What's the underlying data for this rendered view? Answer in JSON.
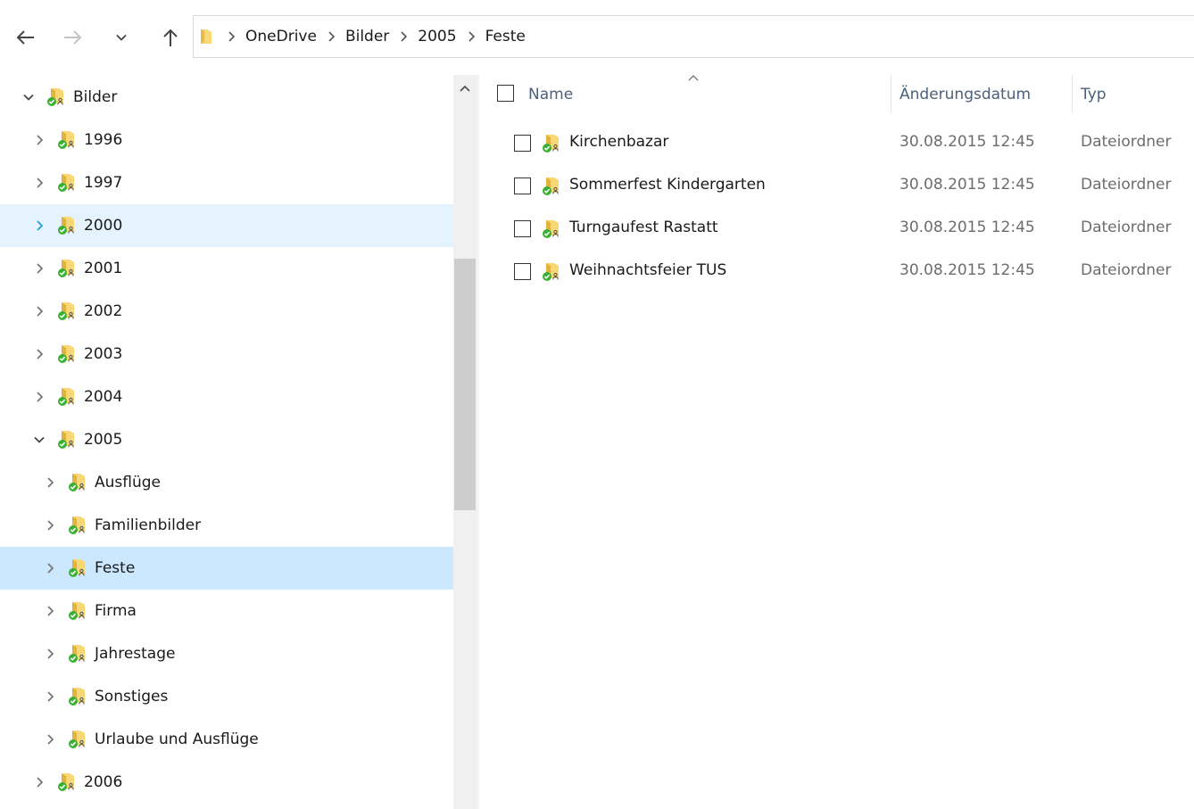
{
  "window": {
    "title": "Feste"
  },
  "breadcrumb": [
    "OneDrive",
    "Bilder",
    "2005",
    "Feste"
  ],
  "icons": {
    "back": "arrow-left-icon",
    "forward": "arrow-right-icon",
    "recent": "chevron-down-icon",
    "up": "arrow-up-icon",
    "folder": "onedrive-shared-folder-icon"
  },
  "colors": {
    "hover_row": "#e5f3ff",
    "selected_row": "#cce8ff",
    "folder": "#f8d775",
    "sync_check": "#3cb034",
    "expand_hover": "#26a0da"
  },
  "nav_tree": [
    {
      "label": "Bilder",
      "level": 0,
      "expanded": true,
      "state": ""
    },
    {
      "label": "1996",
      "level": 1,
      "expanded": false,
      "state": ""
    },
    {
      "label": "1997",
      "level": 1,
      "expanded": false,
      "state": ""
    },
    {
      "label": "2000",
      "level": 1,
      "expanded": false,
      "state": "hover"
    },
    {
      "label": "2001",
      "level": 1,
      "expanded": false,
      "state": ""
    },
    {
      "label": "2002",
      "level": 1,
      "expanded": false,
      "state": ""
    },
    {
      "label": "2003",
      "level": 1,
      "expanded": false,
      "state": ""
    },
    {
      "label": "2004",
      "level": 1,
      "expanded": false,
      "state": ""
    },
    {
      "label": "2005",
      "level": 1,
      "expanded": true,
      "state": ""
    },
    {
      "label": "Ausflüge",
      "level": 2,
      "expanded": false,
      "state": ""
    },
    {
      "label": "Familienbilder",
      "level": 2,
      "expanded": false,
      "state": ""
    },
    {
      "label": "Feste",
      "level": 2,
      "expanded": false,
      "state": "selected"
    },
    {
      "label": "Firma",
      "level": 2,
      "expanded": false,
      "state": ""
    },
    {
      "label": "Jahrestage",
      "level": 2,
      "expanded": false,
      "state": ""
    },
    {
      "label": "Sonstiges",
      "level": 2,
      "expanded": false,
      "state": ""
    },
    {
      "label": "Urlaube und Ausflüge",
      "level": 2,
      "expanded": false,
      "state": ""
    },
    {
      "label": "2006",
      "level": 1,
      "expanded": false,
      "state": ""
    }
  ],
  "columns": {
    "name": "Name",
    "date": "Änderungsdatum",
    "type": "Typ"
  },
  "files": [
    {
      "name": "Kirchenbazar",
      "date": "30.08.2015 12:45",
      "type": "Dateiordner"
    },
    {
      "name": "Sommerfest Kindergarten",
      "date": "30.08.2015 12:45",
      "type": "Dateiordner"
    },
    {
      "name": "Turngaufest Rastatt",
      "date": "30.08.2015 12:45",
      "type": "Dateiordner"
    },
    {
      "name": "Weihnachtsfeier TUS",
      "date": "30.08.2015 12:45",
      "type": "Dateiordner"
    }
  ]
}
